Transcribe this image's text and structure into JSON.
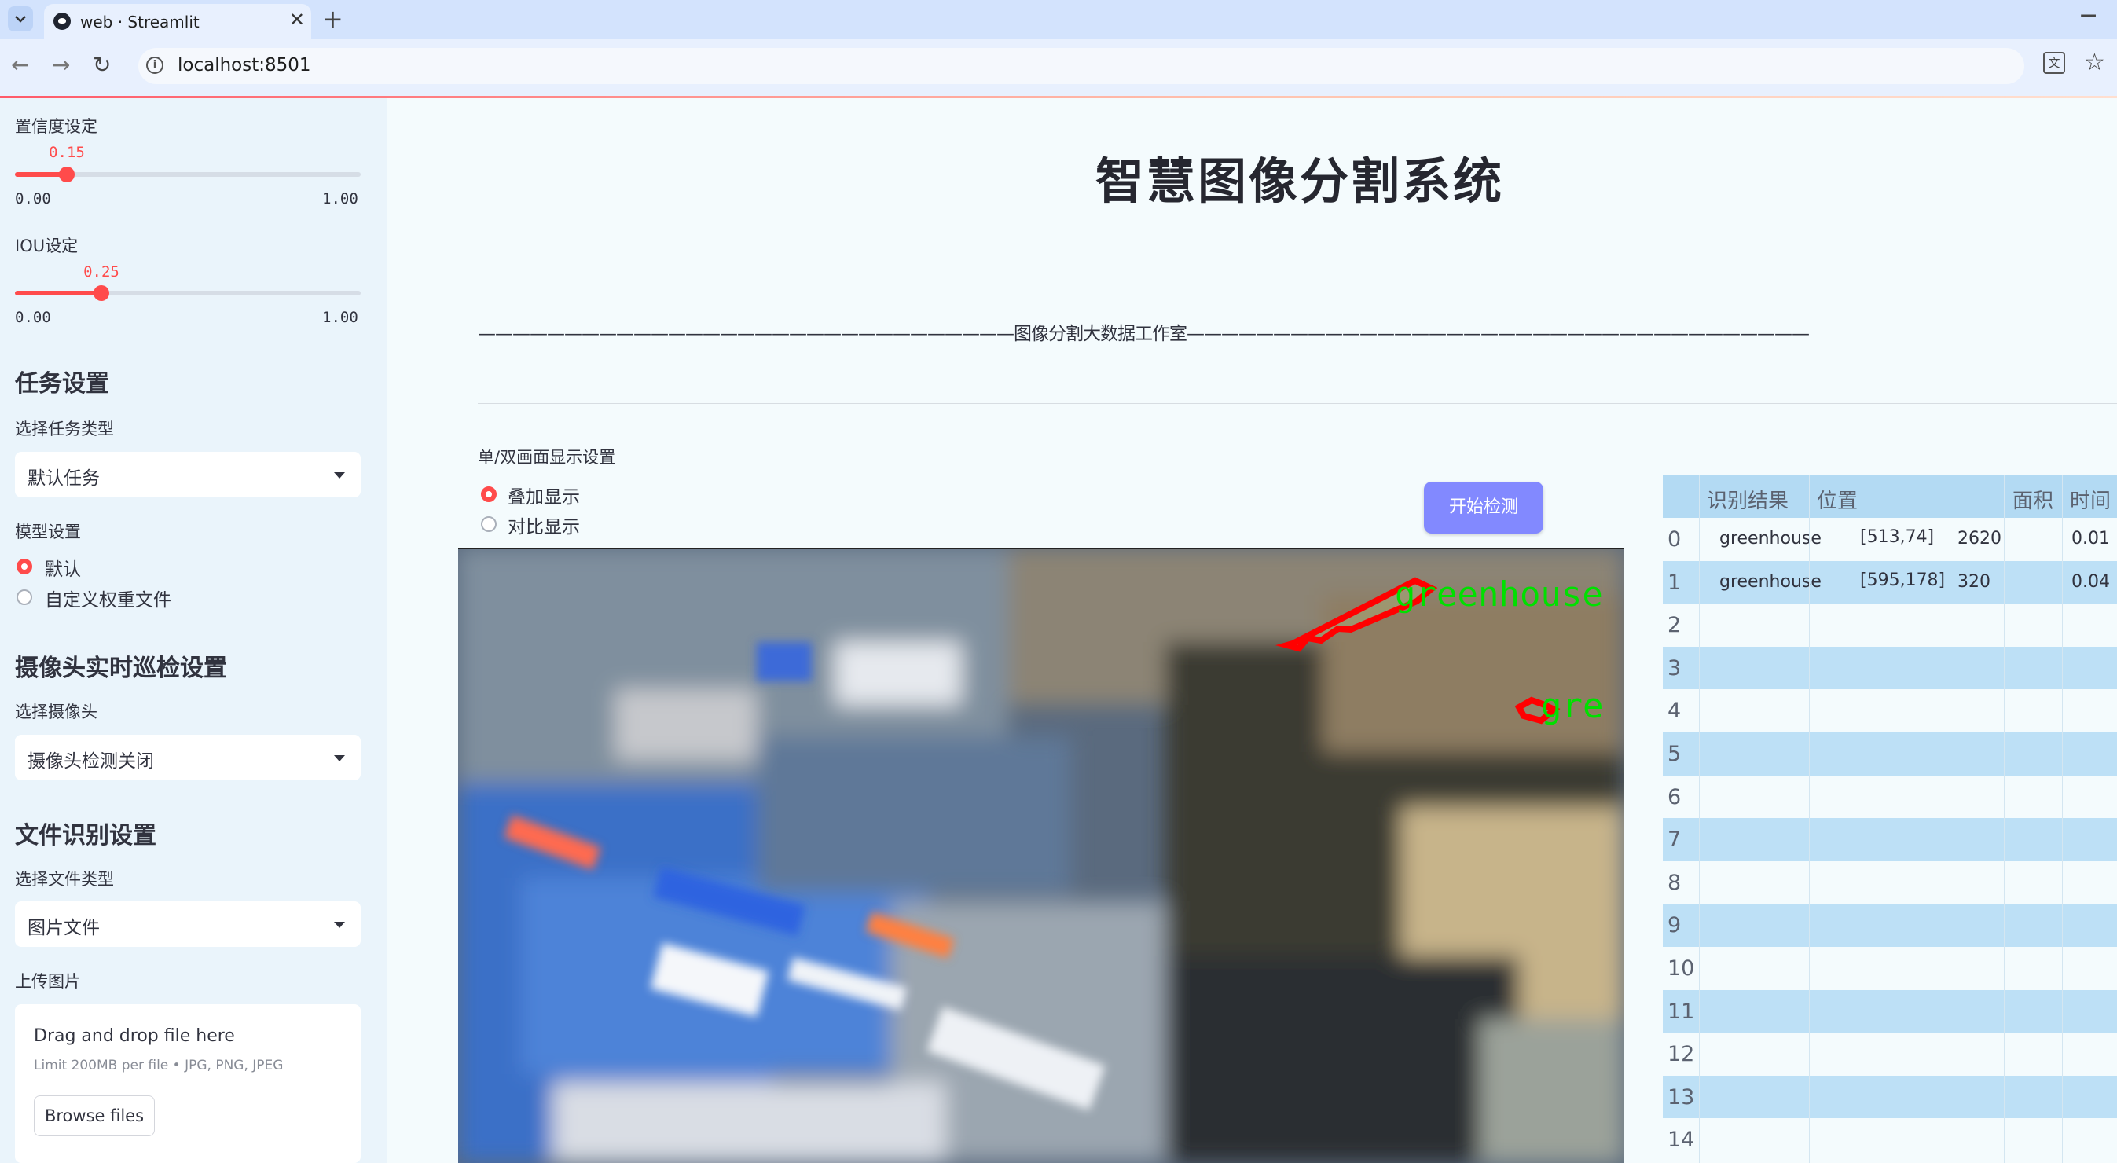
{
  "browser": {
    "tab_title": "web · Streamlit",
    "tab_close": "✕",
    "new_tab": "+",
    "minimize": "−",
    "url": "localhost:8501"
  },
  "sidebar": {
    "confidence": {
      "label": "置信度设定",
      "value": 0.15,
      "value_text": "0.15",
      "min": "0.00",
      "max": "1.00"
    },
    "iou": {
      "label": "IOU设定",
      "value": 0.25,
      "value_text": "0.25",
      "min": "0.00",
      "max": "1.00"
    },
    "task_section": {
      "title": "任务设置",
      "select_label": "选择任务类型",
      "selected": "默认任务"
    },
    "model_section": {
      "label": "模型设置",
      "options": [
        "默认",
        "自定义权重文件"
      ],
      "selected_index": 0
    },
    "camera_section": {
      "title": "摄像头实时巡检设置",
      "select_label": "选择摄像头",
      "selected": "摄像头检测关闭"
    },
    "file_section": {
      "title": "文件识别设置",
      "select_label": "选择文件类型",
      "selected": "图片文件",
      "upload_label": "上传图片"
    },
    "uploader": {
      "drop_text": "Drag and drop file here",
      "limit_text": "Limit 200MB per file • JPG, PNG, JPEG",
      "browse_label": "Browse files"
    }
  },
  "main": {
    "title": "智慧图像分割系统",
    "banner": "———————————————————————————————图像分割大数据工作室————————————————————————————————————",
    "display_label": "单/双画面显示设置",
    "display_options": [
      "叠加显示",
      "对比显示"
    ],
    "display_selected_index": 0,
    "start_button": "开始检测",
    "detections": [
      {
        "label": "greenhouse"
      },
      {
        "label": "gre"
      }
    ]
  },
  "table": {
    "headers": [
      "识别结果",
      "位置",
      "面积",
      "时间"
    ],
    "rows": [
      {
        "index": "0",
        "result": "greenhouse",
        "position": "[513,74]",
        "area": "2620",
        "time": "0.01"
      },
      {
        "index": "1",
        "result": "greenhouse",
        "position": "[595,178]",
        "area": "320",
        "time": "0.04"
      },
      {
        "index": "2",
        "result": "",
        "position": "",
        "area": "",
        "time": ""
      },
      {
        "index": "3",
        "result": "",
        "position": "",
        "area": "",
        "time": ""
      },
      {
        "index": "4",
        "result": "",
        "position": "",
        "area": "",
        "time": ""
      },
      {
        "index": "5",
        "result": "",
        "position": "",
        "area": "",
        "time": ""
      },
      {
        "index": "6",
        "result": "",
        "position": "",
        "area": "",
        "time": ""
      },
      {
        "index": "7",
        "result": "",
        "position": "",
        "area": "",
        "time": ""
      },
      {
        "index": "8",
        "result": "",
        "position": "",
        "area": "",
        "time": ""
      },
      {
        "index": "9",
        "result": "",
        "position": "",
        "area": "",
        "time": ""
      },
      {
        "index": "10",
        "result": "",
        "position": "",
        "area": "",
        "time": ""
      },
      {
        "index": "11",
        "result": "",
        "position": "",
        "area": "",
        "time": ""
      },
      {
        "index": "12",
        "result": "",
        "position": "",
        "area": "",
        "time": ""
      },
      {
        "index": "13",
        "result": "",
        "position": "",
        "area": "",
        "time": ""
      },
      {
        "index": "14",
        "result": "",
        "position": "",
        "area": "",
        "time": ""
      }
    ]
  },
  "colors": {
    "accent": "#ff4b4b",
    "button": "#8289ff",
    "mask_outline": "#ff0000",
    "label_text": "#00e000"
  }
}
